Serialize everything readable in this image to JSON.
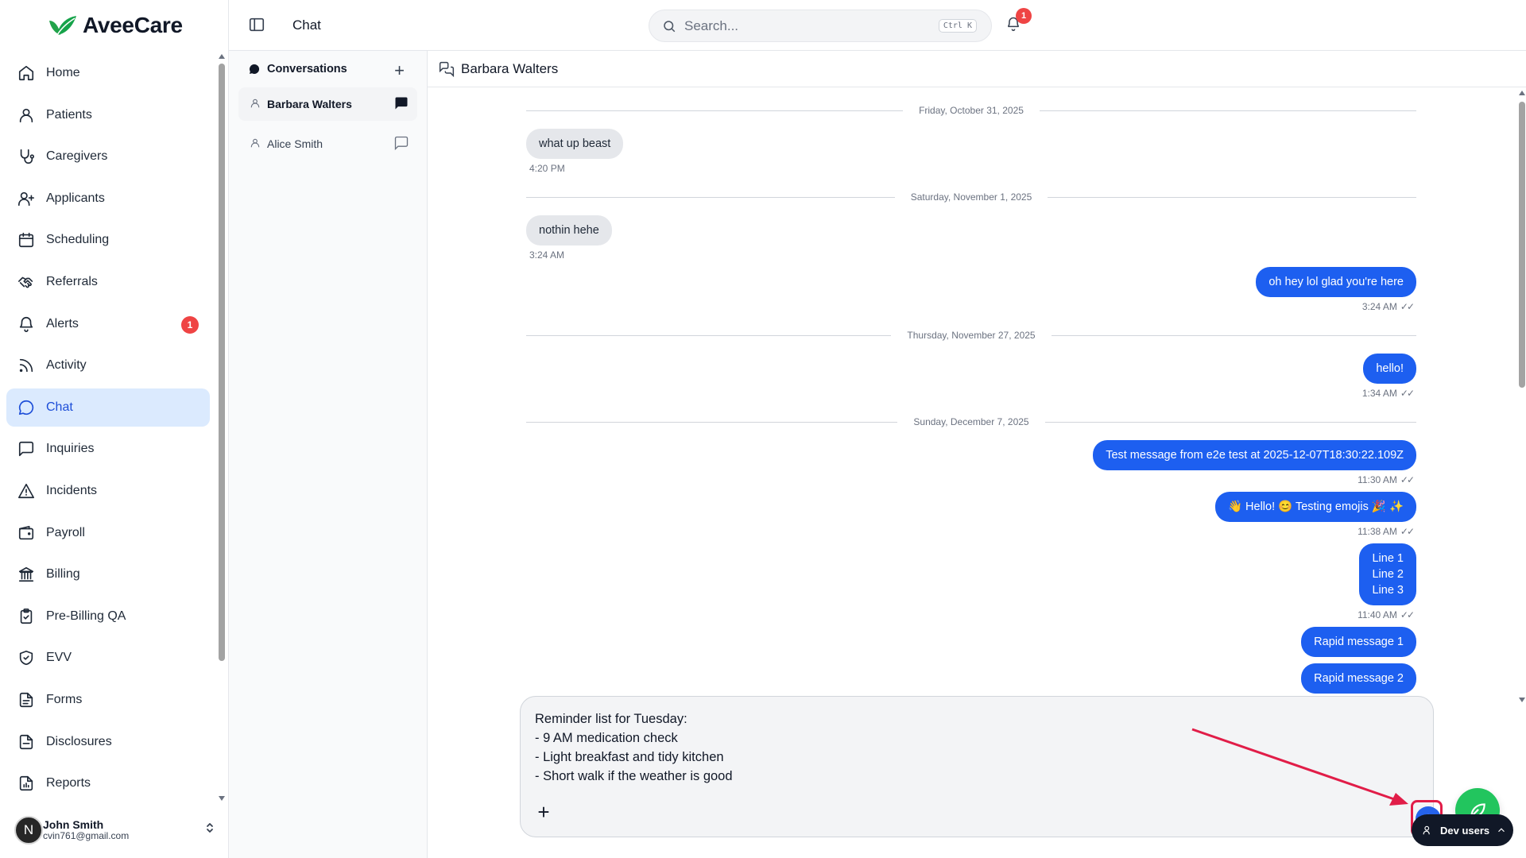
{
  "app": {
    "brand": "AveeCare",
    "page_title": "Chat"
  },
  "sidebar": {
    "items": [
      {
        "label": "Home",
        "icon": "home-icon"
      },
      {
        "label": "Patients",
        "icon": "user-icon"
      },
      {
        "label": "Caregivers",
        "icon": "stethoscope-icon"
      },
      {
        "label": "Applicants",
        "icon": "user-plus-icon"
      },
      {
        "label": "Scheduling",
        "icon": "calendar-icon"
      },
      {
        "label": "Referrals",
        "icon": "handshake-icon"
      },
      {
        "label": "Alerts",
        "icon": "bell-icon",
        "badge": "1"
      },
      {
        "label": "Activity",
        "icon": "rss-icon"
      },
      {
        "label": "Chat",
        "icon": "message-circle-icon",
        "active": true
      },
      {
        "label": "Inquiries",
        "icon": "message-square-icon"
      },
      {
        "label": "Incidents",
        "icon": "alert-triangle-icon"
      },
      {
        "label": "Payroll",
        "icon": "wallet-icon"
      },
      {
        "label": "Billing",
        "icon": "landmark-icon"
      },
      {
        "label": "Pre-Billing QA",
        "icon": "clipboard-check-icon"
      },
      {
        "label": "EVV",
        "icon": "shield-check-icon"
      },
      {
        "label": "Forms",
        "icon": "file-text-icon"
      },
      {
        "label": "Disclosures",
        "icon": "file-icon"
      },
      {
        "label": "Reports",
        "icon": "file-chart-icon"
      }
    ],
    "user": {
      "initial": "N",
      "name": "John Smith",
      "email": "cvin761@gmail.com"
    }
  },
  "topbar": {
    "search_placeholder": "Search...",
    "search_shortcut": "Ctrl K",
    "notification_count": "1"
  },
  "conversations": {
    "title": "Conversations",
    "add_label": "+",
    "items": [
      {
        "name": "Barbara Walters",
        "active": true
      },
      {
        "name": "Alice Smith",
        "active": false
      }
    ]
  },
  "chat": {
    "contact": "Barbara Walters",
    "timeline": [
      {
        "type": "date",
        "text": "Friday, October 31, 2025"
      },
      {
        "type": "in",
        "text": "what up beast",
        "time": "4:20 PM"
      },
      {
        "type": "date",
        "text": "Saturday, November 1, 2025"
      },
      {
        "type": "in",
        "text": "nothin hehe",
        "time": "3:24 AM"
      },
      {
        "type": "out",
        "text": "oh hey lol glad you're here",
        "time": "3:24 AM"
      },
      {
        "type": "date",
        "text": "Thursday, November 27, 2025"
      },
      {
        "type": "out",
        "text": "hello!",
        "time": "1:34 AM"
      },
      {
        "type": "date",
        "text": "Sunday, December 7, 2025"
      },
      {
        "type": "out",
        "text": "Test message from e2e test at 2025-12-07T18:30:22.109Z",
        "time": "11:30 AM"
      },
      {
        "type": "out",
        "text": "👋 Hello! 😊 Testing emojis 🎉 ✨",
        "time": "11:38 AM"
      },
      {
        "type": "out",
        "text": "Line 1\nLine 2\nLine 3",
        "time": "11:40 AM"
      },
      {
        "type": "out",
        "text": "Rapid message 1",
        "time": ""
      },
      {
        "type": "out",
        "text": "Rapid message 2",
        "time": ""
      }
    ],
    "read_ticks": "✓✓"
  },
  "composer": {
    "value": "Reminder list for Tuesday:\n- 9 AM medication check\n- Light breakfast and tidy kitchen\n- Short walk if the weather is good",
    "attach_label": "+"
  },
  "dev": {
    "label": "Dev users"
  },
  "colors": {
    "accent": "#1d5ff0",
    "active_nav_bg": "#dbeafe",
    "badge": "#ef4444",
    "annotation": "#e11d48",
    "fab": "#22c55e"
  }
}
